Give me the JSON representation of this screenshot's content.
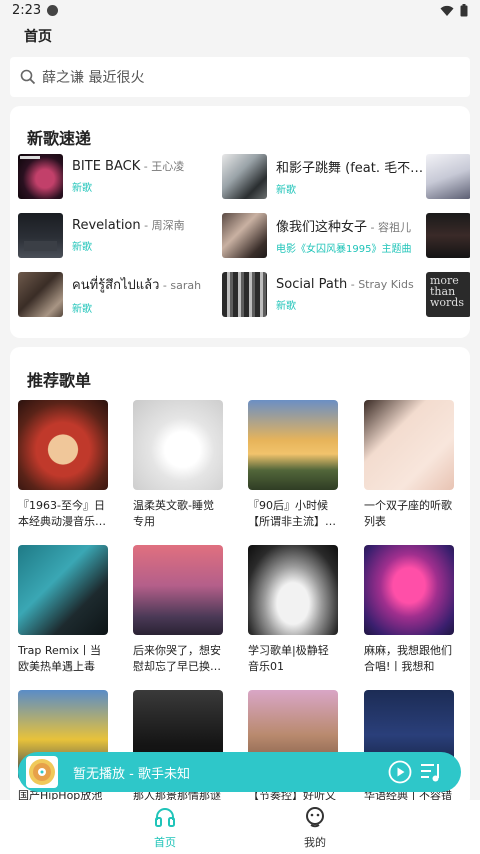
{
  "status": {
    "time": "2:23"
  },
  "header": {
    "title": "首页"
  },
  "search": {
    "placeholder": "薛之谦 最近很火"
  },
  "new_songs": {
    "title": "新歌速递",
    "items": [
      {
        "title": "BITE BACK",
        "artist": " - 王心凌",
        "tag": "新歌"
      },
      {
        "title": "和影子跳舞 (feat. 毛不…",
        "artist": "",
        "tag": "新歌"
      },
      {
        "title": "Revelation",
        "artist": " - 周深南",
        "tag": "新歌"
      },
      {
        "title": "像我们这种女子",
        "artist": " - 容祖儿",
        "tag": "电影《女囚风暴1995》主题曲"
      },
      {
        "title": "คนที่รู้สึกไปแล้ว",
        "artist": " - sarah",
        "tag": "新歌"
      },
      {
        "title": "Social Path",
        "artist": " - Stray Kids",
        "tag": "新歌"
      }
    ],
    "peek_cover_text": "more than words"
  },
  "playlists": {
    "title": "推荐歌单",
    "items": [
      {
        "name": "『1963-至今』日本经典动漫音乐…"
      },
      {
        "name": "温柔英文歌-睡觉专用"
      },
      {
        "name": "『90后』小时候【所谓非主流】…"
      },
      {
        "name": "一个双子座的听歌列表"
      },
      {
        "name": "Trap Remix丨当欧美热单遇上毒性…"
      },
      {
        "name": "后来你哭了，想安慰却忘了早已换…"
      },
      {
        "name": "学习歌单|极静轻音乐01"
      },
      {
        "name": "麻麻，我想跟他们合唱!丨我想和你…"
      },
      {
        "name": "国产HipHop放池"
      },
      {
        "name": "那人那景那情那谜"
      },
      {
        "name": "【节奏控】好听又"
      },
      {
        "name": "华语经典丨不容错"
      }
    ]
  },
  "player": {
    "text": "暂无播放 - 歌手未知"
  },
  "nav": {
    "home": "首页",
    "mine": "我的"
  },
  "colors": {
    "accent": "#2ec7c9",
    "tag": "#20c4b9"
  }
}
